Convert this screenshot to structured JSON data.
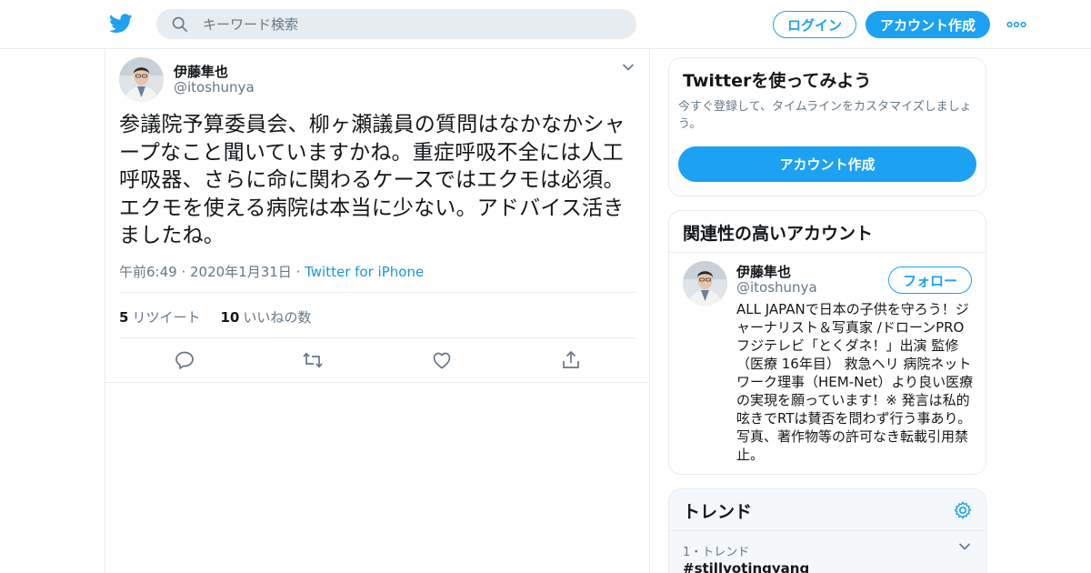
{
  "header": {
    "search_placeholder": "キーワード検索",
    "login_label": "ログイン",
    "signup_label": "アカウント作成"
  },
  "tweet": {
    "author_name": "伊藤隼也",
    "author_handle": "@itoshunya",
    "text": "参議院予算委員会、柳ヶ瀬議員の質問はなかなかシャープなこと聞いていますかね。重症呼吸不全には人工呼吸器、さらに命に関わるケースではエクモは必須。エクモを使える病院は本当に少ない。アドバイス活きましたね。",
    "timestamp": "午前6:49 · 2020年1月31日",
    "separator": " · ",
    "source": "Twitter for iPhone",
    "retweet_count": "5",
    "retweet_label": "リツイート",
    "like_count": "10",
    "like_label": "いいねの数"
  },
  "sidebar": {
    "try_card": {
      "title": "Twitterを使ってみよう",
      "description": "今すぐ登録して、タイムラインをカスタマイズしましょう。",
      "button_label": "アカウント作成"
    },
    "related_card": {
      "title": "関連性の高いアカウント",
      "account": {
        "name": "伊藤隼也",
        "handle": "@itoshunya",
        "follow_label": "フォロー",
        "bio": "ALL JAPANで日本の子供を守ろう！ジャーナリスト＆写真家 /ドローンPRO フジテレビ「とくダネ！」出演 監修（医療 16年目） 救急ヘリ 病院ネットワーク理事（HEM-Net）より良い医療の実現を願っています！※ 発言は私的呟きでRTは賛否を問わず行う事あり。写真、著作物等の許可なき転載引用禁止。"
      }
    },
    "trends_card": {
      "title": "トレンド",
      "items": [
        {
          "meta": "1・トレンド",
          "name": "#stillvotingyang"
        }
      ]
    }
  },
  "colors": {
    "brand_blue": "#1da1f2",
    "link_blue": "#1b95e0",
    "secondary_text": "#657786",
    "border": "#e6ecf0"
  },
  "icons": {
    "logo": "twitter-bird-icon",
    "search": "search-icon",
    "more": "more-dots-icon",
    "reply": "reply-icon",
    "retweet": "retweet-icon",
    "like": "heart-icon",
    "share": "share-icon",
    "settings": "gear-icon"
  }
}
